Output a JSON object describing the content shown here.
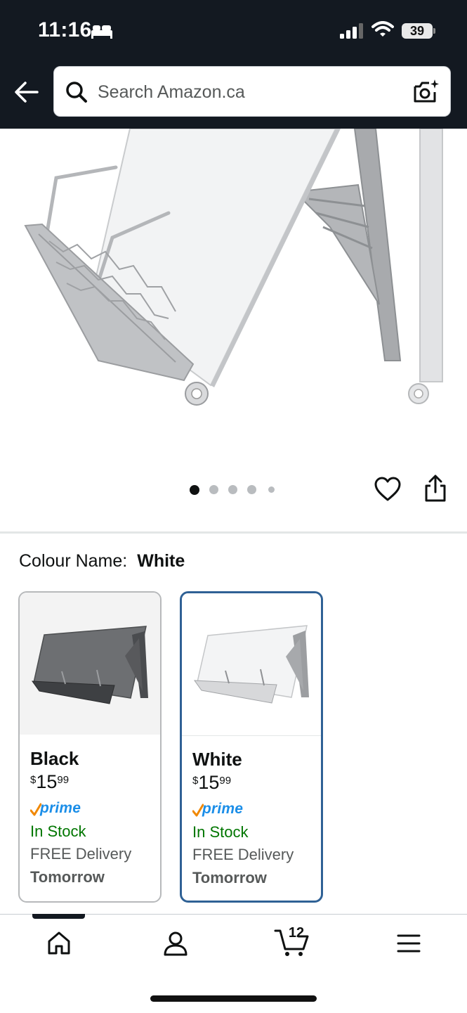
{
  "status": {
    "time": "11:16",
    "battery": "39"
  },
  "search": {
    "placeholder": "Search Amazon.ca"
  },
  "gallery": {
    "image_count": 5,
    "active_index": 0
  },
  "colour": {
    "label": "Colour Name:",
    "selected_value": "White"
  },
  "variants": [
    {
      "name": "Black",
      "price_symbol": "$",
      "price_whole": "15",
      "price_fraction": "99",
      "prime": "prime",
      "stock": "In Stock",
      "delivery": "FREE Delivery",
      "delivery_day": "Tomorrow",
      "selected": false
    },
    {
      "name": "White",
      "price_symbol": "$",
      "price_whole": "15",
      "price_fraction": "99",
      "prime": "prime",
      "stock": "In Stock",
      "delivery": "FREE Delivery",
      "delivery_day": "Tomorrow",
      "selected": true
    }
  ],
  "nav": {
    "cart_count": "12"
  },
  "colors": {
    "header_bg": "#131921",
    "selected_border": "#2f6195",
    "in_stock": "#007600",
    "prime_blue": "#1b8ee8",
    "prime_check": "#f08804"
  },
  "icons": [
    "bed-icon",
    "signal-icon",
    "wifi-icon",
    "back-arrow-icon",
    "search-icon",
    "camera-icon",
    "heart-icon",
    "share-icon",
    "home-icon",
    "user-icon",
    "cart-icon",
    "menu-icon"
  ]
}
